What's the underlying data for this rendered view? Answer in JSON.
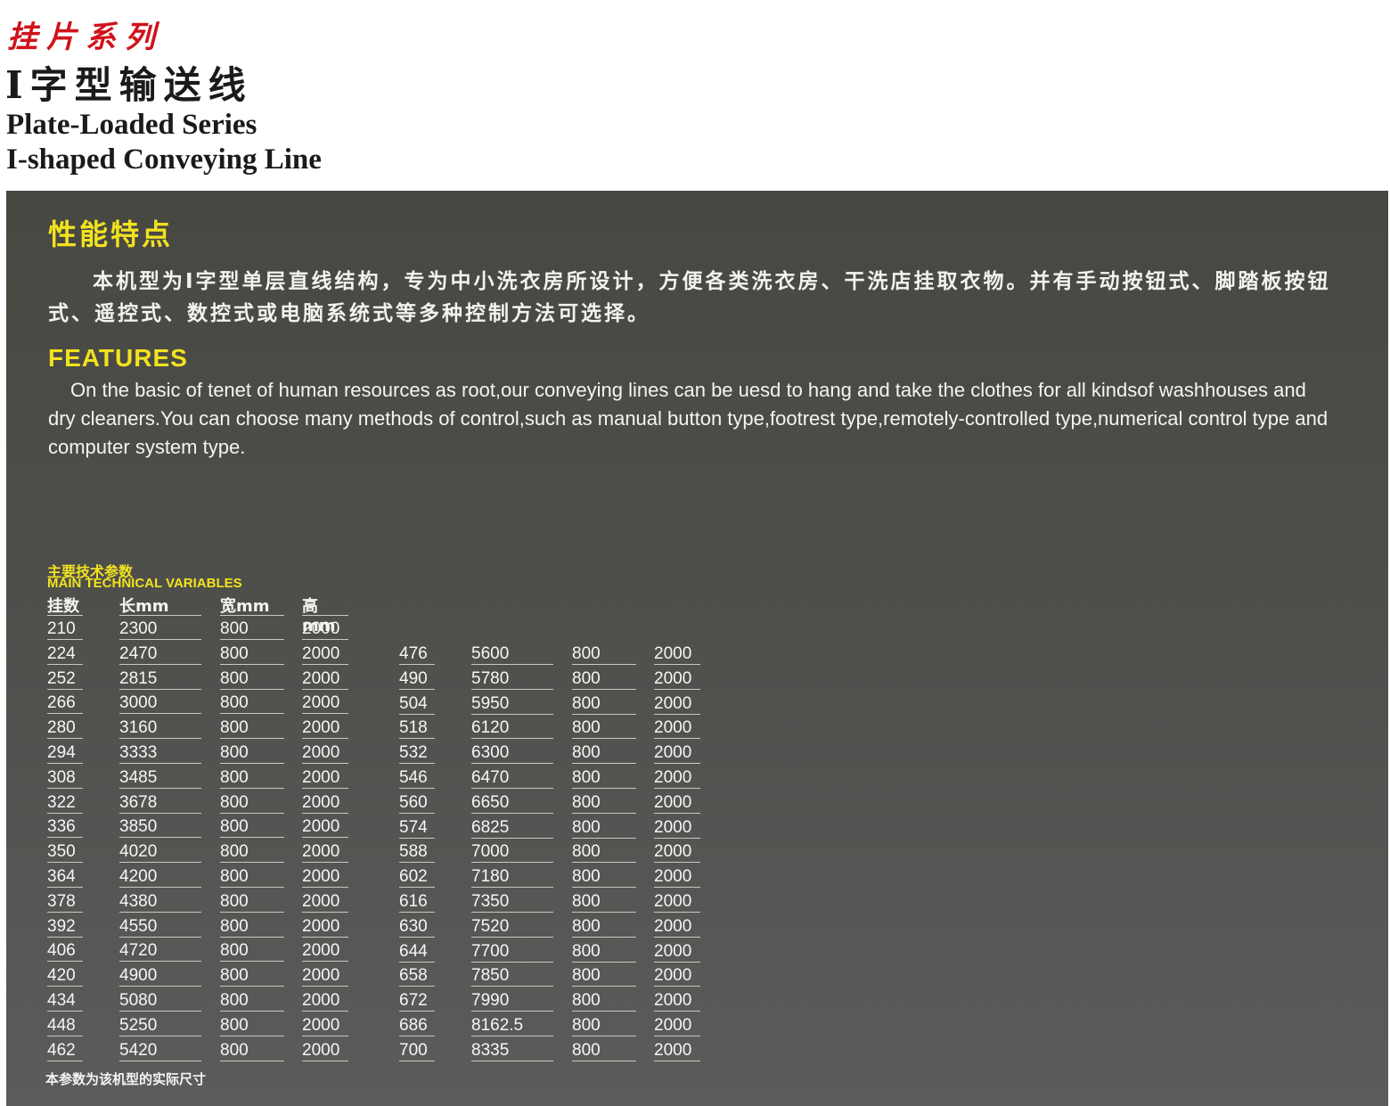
{
  "header": {
    "series_cn": "挂片系列",
    "line_cn": "I字型输送线",
    "series_en": "Plate-Loaded Series",
    "line_en": "I-shaped Conveying Line"
  },
  "performance": {
    "title": "性能特点",
    "body": "本机型为I字型单层直线结构，专为中小洗衣房所设计，方便各类洗衣房、干洗店挂取衣物。并有手动按钮式、脚踏板按钮式、遥控式、数控式或电脑系统式等多种控制方法可选择。"
  },
  "features": {
    "title": "FEATURES",
    "body": "On the basic of tenet of human resources as root,our conveying lines can be uesd to hang and take the clothes for all kindsof washhouses and dry cleaners.You can choose many methods of control,such as manual button type,footrest type,remotely-controlled type,numerical control type and computer system type."
  },
  "specs": {
    "title_cn": "主要技术参数",
    "title_en": "MAIN TECHNICAL VARIABLES",
    "headers": [
      "挂数",
      "长mm",
      "宽mm",
      "高mm"
    ],
    "left_rows": [
      [
        "210",
        "2300",
        "800",
        "2000"
      ],
      [
        "224",
        "2470",
        "800",
        "2000"
      ],
      [
        "252",
        "2815",
        "800",
        "2000"
      ],
      [
        "266",
        "3000",
        "800",
        "2000"
      ],
      [
        "280",
        "3160",
        "800",
        "2000"
      ],
      [
        "294",
        "3333",
        "800",
        "2000"
      ],
      [
        "308",
        "3485",
        "800",
        "2000"
      ],
      [
        "322",
        "3678",
        "800",
        "2000"
      ],
      [
        "336",
        "3850",
        "800",
        "2000"
      ],
      [
        "350",
        "4020",
        "800",
        "2000"
      ],
      [
        "364",
        "4200",
        "800",
        "2000"
      ],
      [
        "378",
        "4380",
        "800",
        "2000"
      ],
      [
        "392",
        "4550",
        "800",
        "2000"
      ],
      [
        "406",
        "4720",
        "800",
        "2000"
      ],
      [
        "420",
        "4900",
        "800",
        "2000"
      ],
      [
        "434",
        "5080",
        "800",
        "2000"
      ],
      [
        "448",
        "5250",
        "800",
        "2000"
      ],
      [
        "462",
        "5420",
        "800",
        "2000"
      ]
    ],
    "right_rows": [
      [
        "476",
        "5600",
        "800",
        "2000"
      ],
      [
        "490",
        "5780",
        "800",
        "2000"
      ],
      [
        "504",
        "5950",
        "800",
        "2000"
      ],
      [
        "518",
        "6120",
        "800",
        "2000"
      ],
      [
        "532",
        "6300",
        "800",
        "2000"
      ],
      [
        "546",
        "6470",
        "800",
        "2000"
      ],
      [
        "560",
        "6650",
        "800",
        "2000"
      ],
      [
        "574",
        "6825",
        "800",
        "2000"
      ],
      [
        "588",
        "7000",
        "800",
        "2000"
      ],
      [
        "602",
        "7180",
        "800",
        "2000"
      ],
      [
        "616",
        "7350",
        "800",
        "2000"
      ],
      [
        "630",
        "7520",
        "800",
        "2000"
      ],
      [
        "644",
        "7700",
        "800",
        "2000"
      ],
      [
        "658",
        "7850",
        "800",
        "2000"
      ],
      [
        "672",
        "7990",
        "800",
        "2000"
      ],
      [
        "686",
        "8162.5",
        "800",
        "2000"
      ],
      [
        "700",
        "8335",
        "800",
        "2000"
      ]
    ],
    "note": "本参数为该机型的实际尺寸"
  }
}
